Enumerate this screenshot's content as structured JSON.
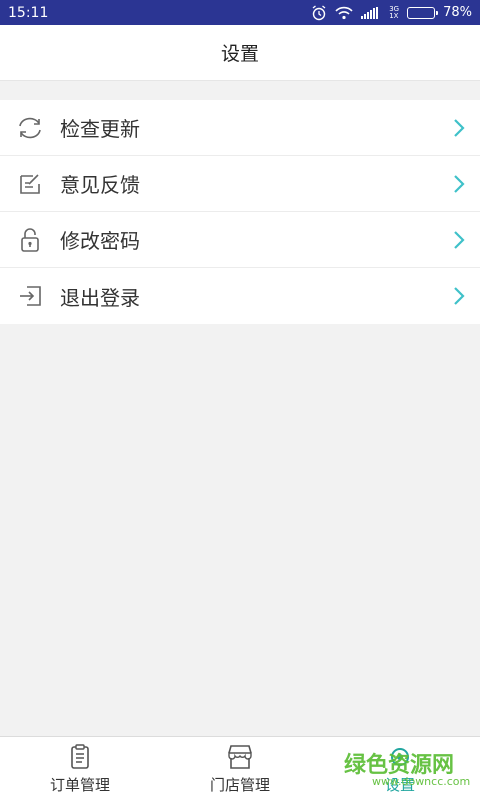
{
  "status_bar": {
    "time": "15:11",
    "network_label": "3G",
    "network_label_2": "1X",
    "battery_percent": "78%",
    "battery_level": 0.78,
    "icons": [
      "alarm-icon",
      "wifi-icon",
      "signal-icon",
      "battery-icon"
    ]
  },
  "header": {
    "title": "设置"
  },
  "menu": {
    "items": [
      {
        "label": "检查更新",
        "icon": "refresh-icon"
      },
      {
        "label": "意见反馈",
        "icon": "feedback-edit-icon"
      },
      {
        "label": "修改密码",
        "icon": "lock-icon"
      },
      {
        "label": "退出登录",
        "icon": "logout-icon"
      }
    ],
    "chevron_color": "#3fc1c9"
  },
  "bottom_nav": {
    "items": [
      {
        "label": "订单管理",
        "icon": "clipboard-icon"
      },
      {
        "label": "门店管理",
        "icon": "store-icon"
      },
      {
        "label": "设置",
        "icon": "settings-icon",
        "active": true
      }
    ],
    "active_color": "#22a6a0"
  },
  "watermark": {
    "text": "绿色资源网",
    "sub": "www.downcc.com"
  }
}
